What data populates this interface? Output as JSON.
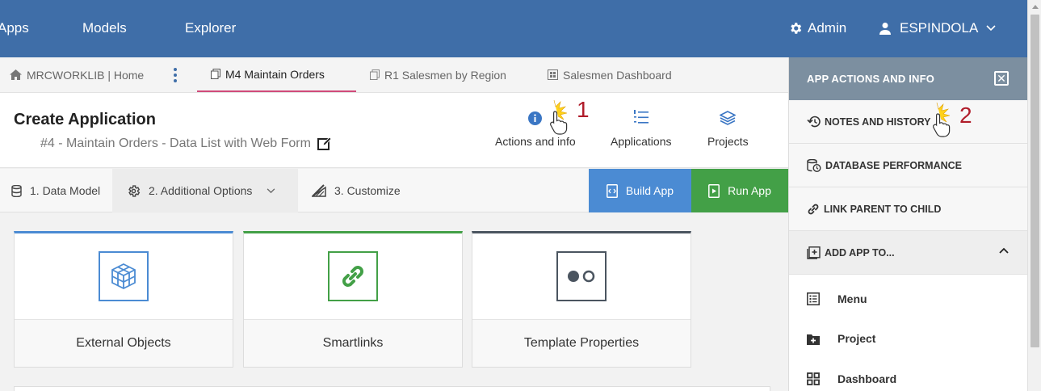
{
  "topbar": {
    "nav": [
      "Apps",
      "Models",
      "Explorer"
    ],
    "admin_label": "Admin",
    "user_label": "ESPINDOLA"
  },
  "tabs": {
    "home": "MRCWORKLIB | Home",
    "items": [
      "M4 Maintain Orders",
      "R1 Salesmen by Region",
      "Salesmen Dashboard"
    ]
  },
  "header": {
    "title": "Create Application",
    "subtitle": "#4 - Maintain Orders - Data List with Web Form",
    "buttons": [
      "Actions and info",
      "Applications",
      "Projects"
    ]
  },
  "steps": {
    "items": [
      "1. Data Model",
      "2. Additional Options",
      "3. Customize"
    ],
    "build_label": "Build App",
    "run_label": "Run App"
  },
  "cards": [
    "External Objects",
    "Smartlinks",
    "Template Properties"
  ],
  "right_panel": {
    "title": "APP ACTIONS AND INFO",
    "items": [
      "NOTES AND HISTORY",
      "DATABASE PERFORMANCE",
      "LINK PARENT TO CHILD",
      "ADD APP TO..."
    ],
    "add_to": [
      "Menu",
      "Project",
      "Dashboard"
    ]
  },
  "annotations": [
    "1",
    "2"
  ],
  "colors": {
    "topbar": "#3f6ea8",
    "build": "#4b8bd3",
    "run": "#43a047",
    "panel_header": "#7c8fa0",
    "active_tab_underline": "#d04a7a",
    "annotation": "#b01c2a"
  }
}
